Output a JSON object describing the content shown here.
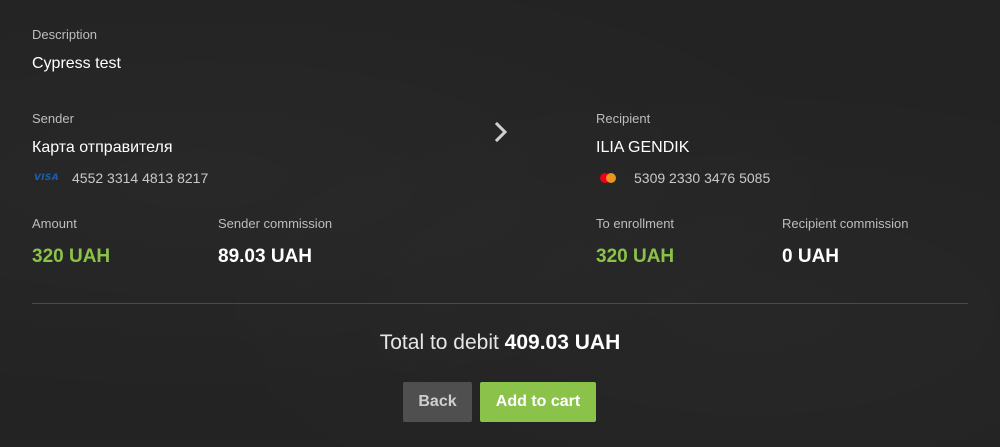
{
  "description": {
    "label": "Description",
    "value": "Cypress test"
  },
  "sender": {
    "label": "Sender",
    "name": "Карта отправителя",
    "card_brand_icon": "visa-icon",
    "card_brand_text": "VISA",
    "card_number": "4552 3314 4813 8217"
  },
  "transfer_arrow_icon": "chevron-right-icon",
  "recipient": {
    "label": "Recipient",
    "name": "ILIA GENDIK",
    "card_brand_icon": "mastercard-icon",
    "card_number": "5309 2330 3476 5085"
  },
  "amounts": {
    "amount_label": "Amount",
    "amount_value": "320 UAH",
    "sender_commission_label": "Sender commission",
    "sender_commission_value": "89.03 UAH",
    "to_enrollment_label": "To enrollment",
    "to_enrollment_value": "320 UAH",
    "recipient_commission_label": "Recipient commission",
    "recipient_commission_value": "0 UAH"
  },
  "total": {
    "label": "Total to debit",
    "value": "409.03 UAH"
  },
  "buttons": {
    "back_label": "Back",
    "add_to_cart_label": "Add to cart"
  },
  "colors": {
    "background": "#232323",
    "accent_green": "#8bc34a",
    "back_button": "#4f4f4f",
    "divider": "#4a4a4a"
  }
}
